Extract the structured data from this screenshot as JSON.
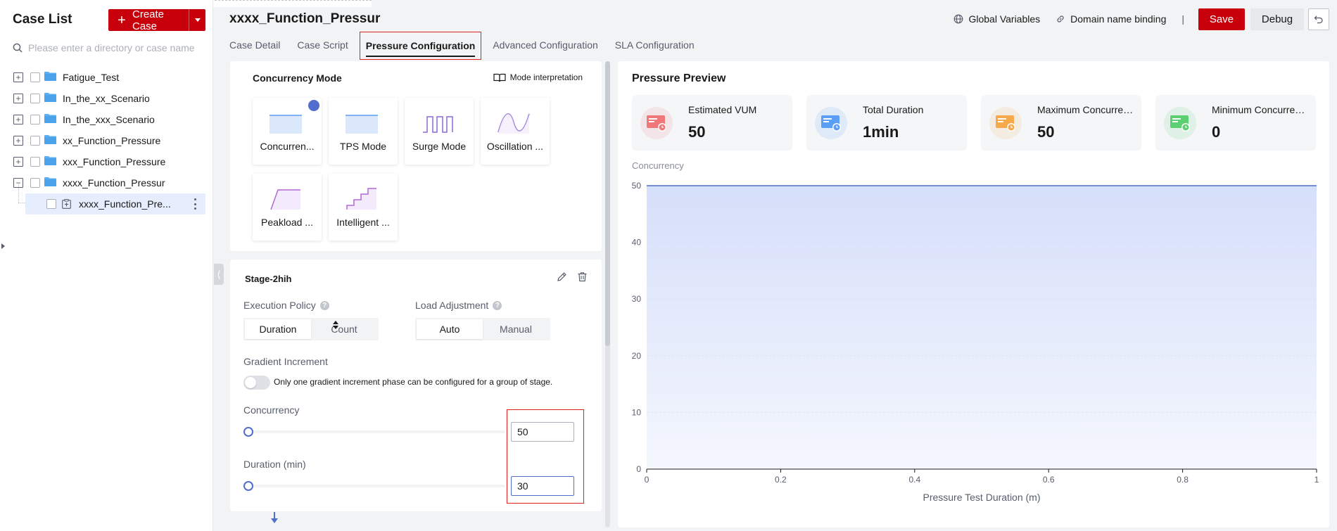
{
  "sidebar": {
    "title": "Case List",
    "create_label": "Create Case",
    "search_placeholder": "Please enter a directory or case name",
    "tree": [
      {
        "label": "Fatigue_Test",
        "expander": "+"
      },
      {
        "label": "In_the_xx_Scenario",
        "expander": "+"
      },
      {
        "label": "In_the_xxx_Scenario",
        "expander": "+"
      },
      {
        "label": "xx_Function_Pressure",
        "expander": "+"
      },
      {
        "label": "xxx_Function_Pressure",
        "expander": "+"
      },
      {
        "label": "xxxx_Function_Pressur",
        "expander": "−"
      }
    ],
    "selected_child": {
      "label": "xxxx_Function_Pre..."
    }
  },
  "header": {
    "title": "xxxx_Function_Pressur",
    "global_variables": "Global Variables",
    "domain_binding": "Domain name binding",
    "separator": "|",
    "save": "Save",
    "debug": "Debug"
  },
  "tabs": [
    {
      "label": "Case Detail",
      "active": false
    },
    {
      "label": "Case Script",
      "active": false
    },
    {
      "label": "Pressure Configuration",
      "active": true
    },
    {
      "label": "Advanced Configuration",
      "active": false
    },
    {
      "label": "SLA Configuration",
      "active": false
    }
  ],
  "mode_panel": {
    "title": "Concurrency Mode",
    "interpretation": "Mode interpretation",
    "modes": [
      {
        "label": "Concurren...",
        "icon": "concurrency-mode-icon",
        "selected": true
      },
      {
        "label": "TPS Mode",
        "icon": "tps-mode-icon",
        "selected": false
      },
      {
        "label": "Surge Mode",
        "icon": "surge-mode-icon",
        "selected": false
      },
      {
        "label": "Oscillation ...",
        "icon": "oscillation-mode-icon",
        "selected": false
      },
      {
        "label": "Peakload ...",
        "icon": "peakload-mode-icon",
        "selected": false
      },
      {
        "label": "Intelligent ...",
        "icon": "intelligent-mode-icon",
        "selected": false
      }
    ]
  },
  "stage": {
    "title": "Stage-2hih",
    "execution_policy": {
      "label": "Execution Policy",
      "options": [
        "Duration",
        "Count"
      ],
      "selected": "Duration"
    },
    "load_adjustment": {
      "label": "Load Adjustment",
      "options": [
        "Auto",
        "Manual"
      ],
      "selected": "Auto"
    },
    "gradient": {
      "label": "Gradient Increment",
      "enabled": false,
      "hint": "Only one gradient increment phase can be configured for a group of stage."
    },
    "concurrency": {
      "label": "Concurrency",
      "value": "50",
      "slider_fraction": 0
    },
    "duration": {
      "label": "Duration (min)",
      "value": "30",
      "slider_fraction": 0
    }
  },
  "preview": {
    "title": "Pressure Preview",
    "stats": [
      {
        "label": "Estimated VUM",
        "value": "50",
        "icon": "estimated-vum-icon",
        "color": "#f0787a"
      },
      {
        "label": "Total Duration",
        "value": "1min",
        "icon": "total-duration-icon",
        "color": "#5b9ef5"
      },
      {
        "label": "Maximum Concurrency",
        "value": "50",
        "icon": "maximum-concurrency-icon",
        "color": "#f5a94b"
      },
      {
        "label": "Minimum Concurrency",
        "value": "0",
        "icon": "minimum-concurrency-icon",
        "color": "#5ccf72"
      }
    ]
  },
  "chart_data": {
    "type": "area",
    "ylabel": "Concurrency",
    "xlabel": "Pressure Test Duration (m)",
    "x": [
      0,
      1
    ],
    "series": [
      {
        "values": [
          50,
          50
        ]
      }
    ],
    "xlim": [
      0,
      1
    ],
    "ylim": [
      0,
      50
    ],
    "xticks": [
      "0",
      "0.2",
      "0.4",
      "0.6",
      "0.8",
      "1"
    ],
    "yticks": [
      "0",
      "10",
      "20",
      "30",
      "40",
      "50"
    ],
    "grid": true,
    "line_color": "#526ecc",
    "fill_color": "#d6dffa"
  }
}
